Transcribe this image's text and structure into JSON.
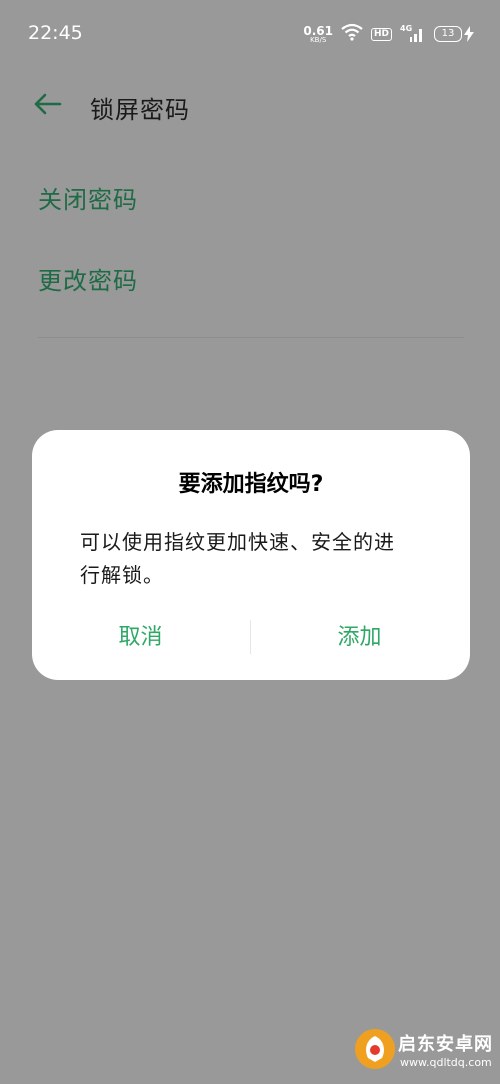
{
  "status_bar": {
    "time": "22:45",
    "net_speed_value": "0.61",
    "net_speed_unit": "KB/S",
    "hd_label": "HD",
    "network_type": "4G",
    "battery_level": "13"
  },
  "header": {
    "title": "锁屏密码"
  },
  "menu": {
    "items": [
      {
        "label": "关闭密码"
      },
      {
        "label": "更改密码"
      }
    ]
  },
  "dialog": {
    "title": "要添加指纹吗?",
    "message_line1": "可以使用指纹更加快速、安全的进",
    "message_line2": "行解锁。",
    "cancel_label": "取消",
    "confirm_label": "添加"
  },
  "watermark": {
    "name": "启东安卓网",
    "url": "www.qdltdq.com"
  },
  "colors": {
    "accent_green": "#2fa866",
    "menu_green": "#1e6b45",
    "overlay_gray": "#999999",
    "dialog_bg": "#ffffff"
  }
}
